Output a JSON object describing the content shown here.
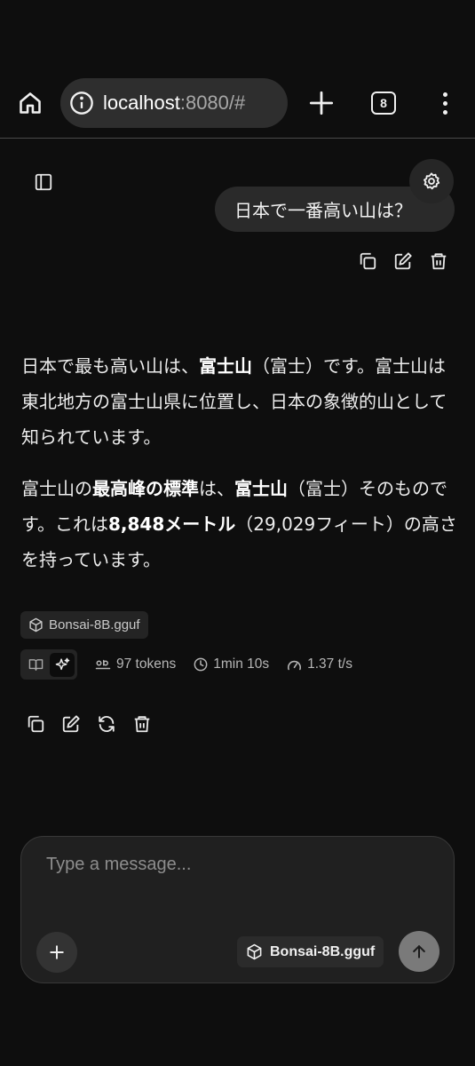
{
  "browser": {
    "url_host": "localhost",
    "url_rest": ":8080/#",
    "tab_count": "8",
    "icons": [
      "home-icon",
      "info-icon",
      "plus-icon",
      "tabs-icon",
      "more-vert-icon"
    ]
  },
  "chat": {
    "user_message": "日本で一番高い山は？",
    "assistant": {
      "p1": [
        {
          "t": "日本で最も高い山は、",
          "b": false
        },
        {
          "t": "富士山",
          "b": true
        },
        {
          "t": "（富士）です。富士山は東北地方の富士山県に位置し、日本の象徴的山として知られています。",
          "b": false
        }
      ],
      "p2": [
        {
          "t": "富士山の",
          "b": false
        },
        {
          "t": "最高峰の標準",
          "b": true
        },
        {
          "t": "は、",
          "b": false
        },
        {
          "t": "富士山",
          "b": true
        },
        {
          "t": "（富士）そのものです。これは",
          "b": false
        },
        {
          "t": "8,848メートル",
          "b": true
        },
        {
          "t": "（29,029フィート）の高さを持っています。",
          "b": false
        }
      ]
    },
    "model_chip": "Bonsai-8B.gguf",
    "stats": {
      "tokens": "97 tokens",
      "time": "1min 10s",
      "speed": "1.37 t/s"
    }
  },
  "composer": {
    "placeholder": "Type a message...",
    "model": "Bonsai-8B.gguf"
  },
  "colors": {
    "background": "#0e0e0e",
    "bubble": "#2a2a2a",
    "send_button": "#7a7a7a"
  }
}
